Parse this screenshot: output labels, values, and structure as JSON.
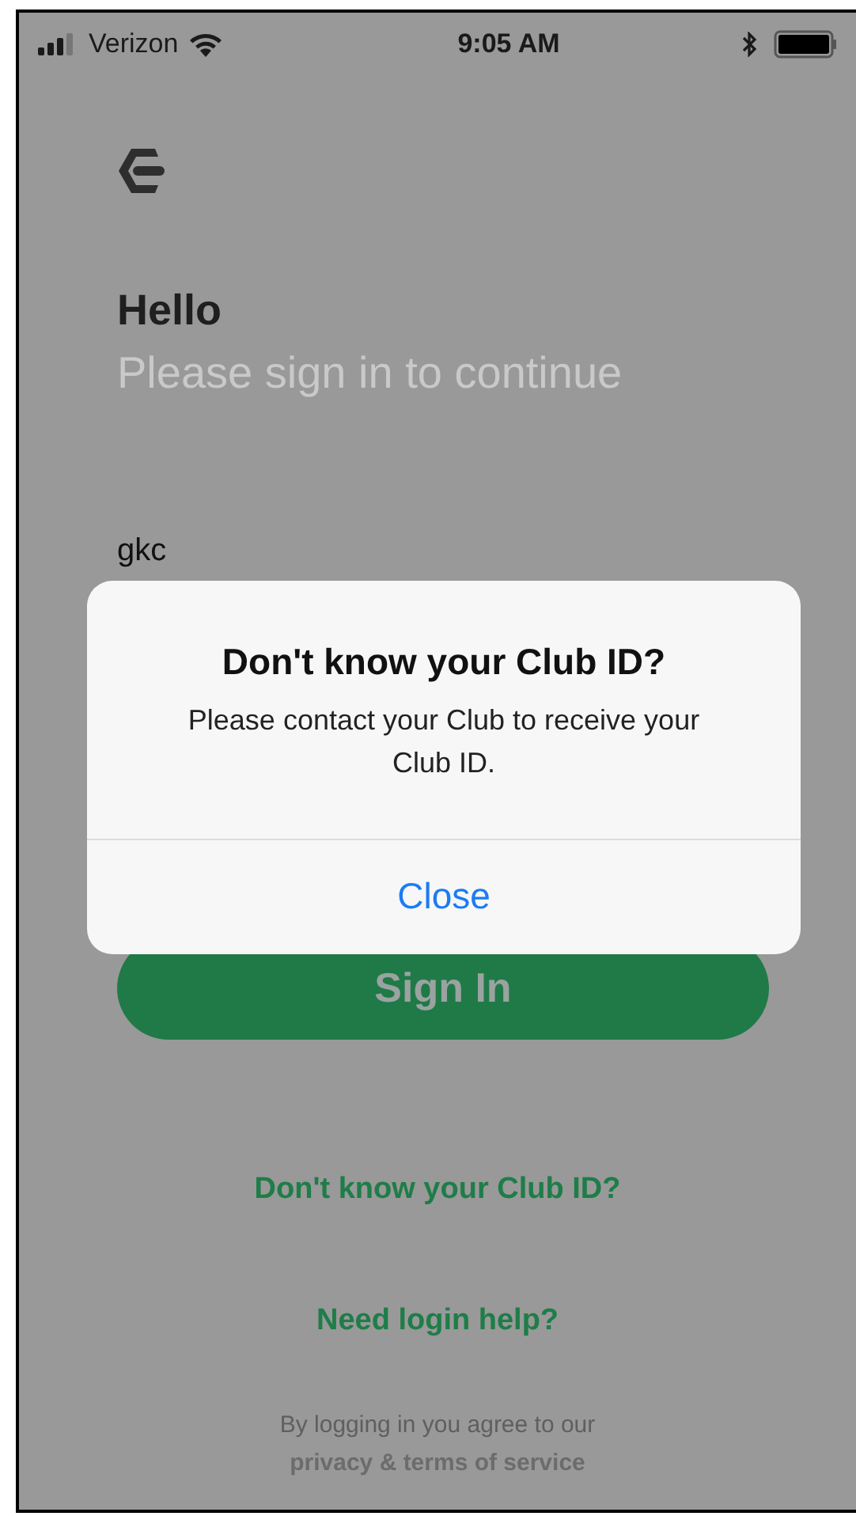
{
  "status_bar": {
    "carrier": "Verizon",
    "time": "9:05 AM"
  },
  "login": {
    "greeting": "Hello",
    "subtitle": "Please sign in to continue",
    "club_id_value": "gkc",
    "sign_in_button": "Sign In",
    "links": [
      "Don't know your Club ID?",
      "Need login help?"
    ],
    "footer": {
      "text": "By logging in you agree to our",
      "link": "privacy & terms of service"
    }
  },
  "alert": {
    "title": "Don't know your Club ID?",
    "message": "Please contact your Club to receive your Club ID.",
    "buttons": [
      "Close"
    ]
  }
}
